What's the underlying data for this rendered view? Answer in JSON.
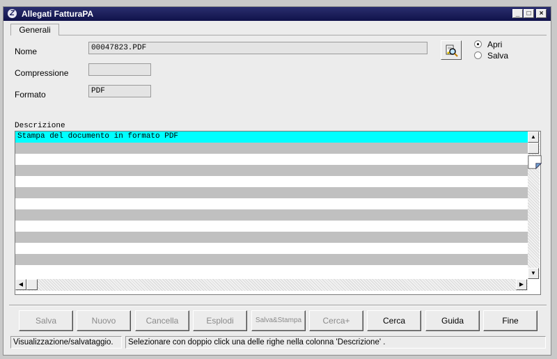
{
  "window": {
    "title": "Allegati FatturaPA",
    "icon": "app-logo-icon",
    "controls": [
      "minimize",
      "maximize",
      "close"
    ]
  },
  "tabs": [
    {
      "label": "Generali",
      "active": true
    }
  ],
  "form": {
    "nome_label": "Nome",
    "nome_value": "00047823.PDF",
    "compressione_label": "Compressione",
    "compressione_value": "",
    "formato_label": "Formato",
    "formato_value": "PDF",
    "open_button_icon": "search-document-icon",
    "radio": [
      {
        "label": "Apri",
        "checked": true
      },
      {
        "label": "Salva",
        "checked": false
      }
    ]
  },
  "descrizione": {
    "header": "Descrizione",
    "rows": [
      "Stampa del documento in formato PDF",
      "",
      "",
      "",
      "",
      "",
      "",
      "",
      "",
      "",
      "",
      "",
      ""
    ],
    "selected_row_color": "#00ffff",
    "alt_row_color": "#c0c0c0"
  },
  "buttons": [
    {
      "label": "Salva",
      "enabled": false
    },
    {
      "label": "Nuovo",
      "enabled": false
    },
    {
      "label": "Cancella",
      "enabled": false
    },
    {
      "label": "Esplodi",
      "enabled": false
    },
    {
      "label": "Salva&Stampa",
      "enabled": false
    },
    {
      "label": "Cerca+",
      "enabled": false
    },
    {
      "label": "Cerca",
      "enabled": true
    },
    {
      "label": "Guida",
      "enabled": true
    },
    {
      "label": "Fine",
      "enabled": true
    }
  ],
  "status": {
    "left": "Visualizzazione/salvataggio.",
    "right": "Selezionare con doppio click una delle righe nella colonna 'Descrizione' ."
  }
}
